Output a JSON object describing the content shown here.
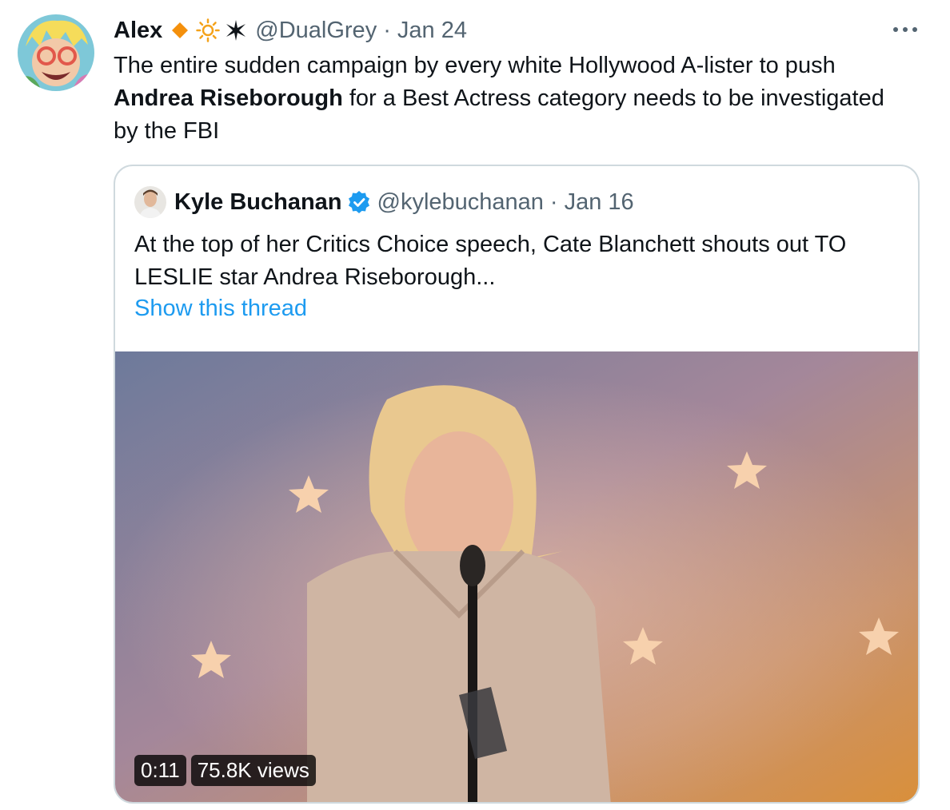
{
  "tweet": {
    "author_name": "Alex",
    "author_handle": "@DualGrey",
    "separator": "·",
    "date": "Jan 24",
    "text_part1": "The entire sudden campaign by every white Hollywood A-lister to push ",
    "text_bold": "Andrea Riseborough",
    "text_part2": " for a Best Actress category needs to be investigated by the FBI",
    "more_icon": "ellipsis-icon",
    "name_emojis": [
      "orange-diamond-icon",
      "sun-icon",
      "star-burst-icon"
    ]
  },
  "quote": {
    "author_name": "Kyle Buchanan",
    "author_handle": "@kylebuchanan",
    "separator": "·",
    "date": "Jan 16",
    "text": "At the top of her Critics Choice speech, Cate Blanchett shouts out TO LESLIE star Andrea Riseborough...",
    "link_label": "Show this thread",
    "verified_icon": "verified-badge-icon"
  },
  "media": {
    "duration": "0:11",
    "views": "75.8K views"
  },
  "colors": {
    "text": "#0f1419",
    "secondary": "#536471",
    "link": "#1d9bf0",
    "border": "#cfd9de"
  }
}
